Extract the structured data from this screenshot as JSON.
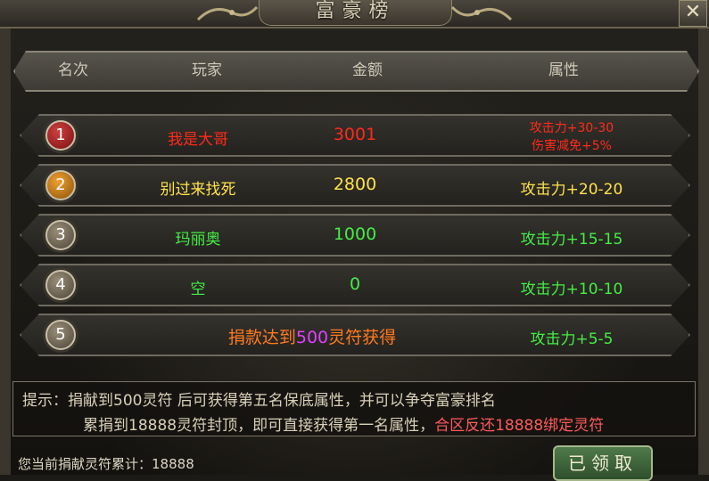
{
  "window": {
    "title": "富豪榜"
  },
  "colors": {
    "red": "#ff2a1a",
    "yellow": "#ffe24a",
    "green": "#44ee44",
    "orange": "#ff7a1e",
    "purple": "#e040ff"
  },
  "columns": {
    "rank": "名次",
    "player": "玩家",
    "amount": "金额",
    "attribute": "属性"
  },
  "rows": [
    {
      "rank": "1",
      "player": "我是大哥",
      "amount": "3001",
      "attr1": "攻击力+30-30",
      "attr2": "伤害减免+5%"
    },
    {
      "rank": "2",
      "player": "别过来找死",
      "amount": "2800",
      "attr1": "攻击力+20-20"
    },
    {
      "rank": "3",
      "player": "玛丽奥",
      "amount": "1000",
      "attr1": "攻击力+15-15"
    },
    {
      "rank": "4",
      "player": "空",
      "amount": "0",
      "attr1": "攻击力+10-10"
    },
    {
      "rank": "5",
      "reward_prefix": "捐款达到",
      "reward_amount": "500",
      "reward_suffix": "灵符获得",
      "attr1": "攻击力+5-5"
    }
  ],
  "hint": {
    "line1": "提示：捐献到500灵符 后可获得第五名保底属性，并可以争夺富豪排名",
    "line2_main": "累捐到18888灵符封顶，即可直接获得第一名属性，",
    "line2_highlight": "合区反还18888绑定灵符"
  },
  "footer": {
    "total_label": "您当前捐献灵符累计：",
    "total_value": "18888"
  },
  "claim_button": "已领取"
}
